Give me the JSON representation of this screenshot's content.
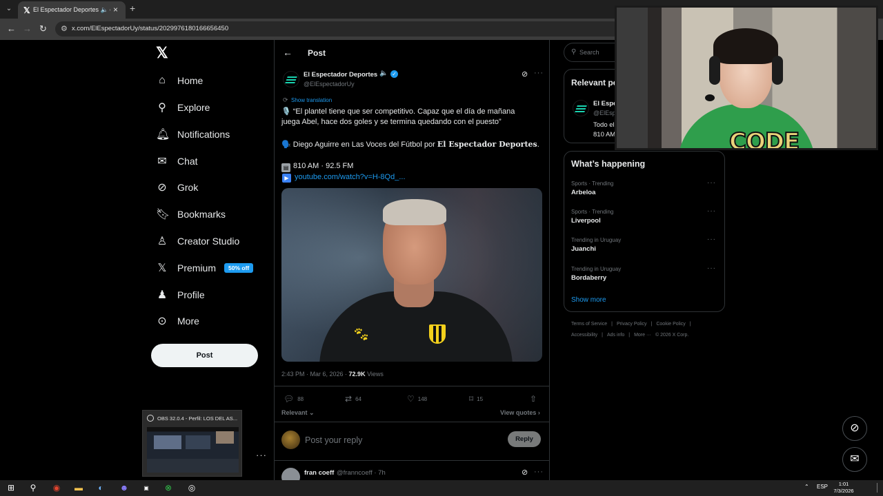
{
  "browser": {
    "tab_title": "El Espectador Deportes 🔈 on X",
    "url": "x.com/ElEspectadorUy/status/2029976180166656450"
  },
  "nav": {
    "items": [
      {
        "label": "Home",
        "icon": "home-icon"
      },
      {
        "label": "Explore",
        "icon": "search-icon"
      },
      {
        "label": "Notifications",
        "icon": "bell-icon"
      },
      {
        "label": "Chat",
        "icon": "mail-icon"
      },
      {
        "label": "Grok",
        "icon": "grok-icon"
      },
      {
        "label": "Bookmarks",
        "icon": "bookmark-icon"
      },
      {
        "label": "Creator Studio",
        "icon": "flask-icon"
      },
      {
        "label": "Premium",
        "icon": "x-icon",
        "badge": "50% off"
      },
      {
        "label": "Profile",
        "icon": "person-icon"
      },
      {
        "label": "More",
        "icon": "more-circle-icon"
      }
    ],
    "post_button": "Post"
  },
  "header": {
    "title": "Post"
  },
  "tweet": {
    "author_name": "El Espectador Deportes",
    "author_emoji": "🔈",
    "author_handle": "@ElEspectadorUy",
    "show_translation": "Show translation",
    "line1": "🎙️ “El plantel tiene que ser competitivo. Capaz que el día de mañana",
    "line2": "juega Abel, hace dos goles y se termina quedando con el puesto”",
    "line3_prefix": "🗣️ Diego Aguirre en Las Voces del Fútbol por ",
    "line3_bold": "𝐄𝐥 𝐄𝐬𝐩𝐞𝐜𝐭𝐚𝐝𝐨𝐫 𝐃𝐞𝐩𝐨𝐫𝐭𝐞𝐬",
    "line3_suffix": ".",
    "radio": "810 AM · 92.5 FM",
    "link": "youtube.com/watch?v=H-8Qd_...",
    "time": "2:43 PM · Mar 6, 2026 · ",
    "views_count": "72.9K",
    "views_label": " Views",
    "replies": "88",
    "reposts": "64",
    "likes": "148",
    "bookmarks": "15"
  },
  "replies_section": {
    "sort": "Relevant",
    "view_quotes": "View quotes",
    "placeholder": "Post your reply",
    "reply_button": "Reply",
    "next_name": "fran coeff",
    "next_handle": "@franncoeff · 7h"
  },
  "right": {
    "search_placeholder": "Search",
    "relevant_title": "Relevant people",
    "relevant_name": "El Espectador Deportes",
    "relevant_handle": "@ElEspectadorUy",
    "relevant_desc1": "Todo el deporte en",
    "relevant_desc2": "810 AM",
    "happening_title": "What’s happening",
    "trends": [
      {
        "category": "Sports · Trending",
        "name": "Arbeloa"
      },
      {
        "category": "Sports · Trending",
        "name": "Liverpool"
      },
      {
        "category": "Trending in Uruguay",
        "name": "Juanchi"
      },
      {
        "category": "Trending in Uruguay",
        "name": "Bordaberry"
      }
    ],
    "show_more": "Show more",
    "footer": [
      "Terms of Service",
      "|",
      "Privacy Policy",
      "|",
      "Cookie Policy",
      "|"
    ],
    "footer2": [
      "Accessibility",
      "|",
      "Ads info",
      "|",
      "More ···",
      "© 2026 X Corp."
    ]
  },
  "webcam": {
    "overlay_text": "CODE"
  },
  "obs": {
    "title": "OBS 32.0.4 - Perfil: LOS DEL AS..."
  },
  "taskbar": {
    "lang": "ESP",
    "time": "1:01",
    "date": "7/3/2026"
  },
  "colors": {
    "accent": "#1d9bf0",
    "background": "#000000",
    "border": "#2f3336"
  }
}
